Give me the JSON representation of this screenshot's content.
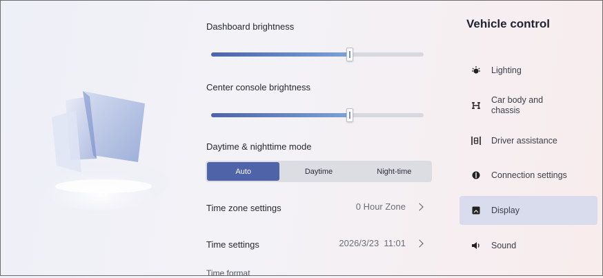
{
  "display": {
    "dashboard_brightness": {
      "label": "Dashboard brightness",
      "level": 0.65
    },
    "center_console_brightness": {
      "label": "Center console brightness",
      "level": 0.65
    },
    "mode": {
      "label": "Daytime & nighttime mode",
      "options": [
        "Auto",
        "Daytime",
        "Night-time"
      ],
      "selected": "Auto"
    },
    "time_zone": {
      "label": "Time zone settings",
      "value": "0 Hour Zone"
    },
    "time": {
      "label": "Time settings",
      "value": "2026/3/23  11:01"
    },
    "time_format": {
      "label": "Time format"
    }
  },
  "sidebar": {
    "title": "Vehicle control",
    "items": [
      {
        "label": "Lighting",
        "icon": "light-icon"
      },
      {
        "label": "Car body and chassis",
        "icon": "car-body-icon"
      },
      {
        "label": "Driver assistance",
        "icon": "driver-assist-icon"
      },
      {
        "label": "Connection settings",
        "icon": "connection-icon"
      },
      {
        "label": "Display",
        "icon": "display-icon"
      },
      {
        "label": "Sound",
        "icon": "sound-icon"
      }
    ],
    "active": "Display"
  },
  "colors": {
    "accent": "#4e63a8",
    "active_bg": "#d9dced"
  }
}
